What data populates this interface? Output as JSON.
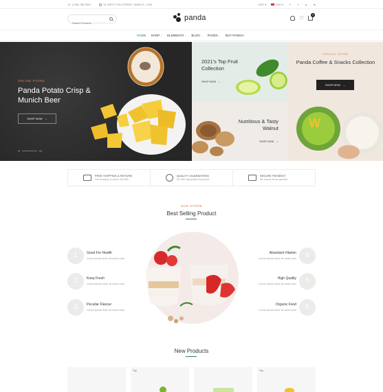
{
  "topbar": {
    "phone": "(+84) 789 9521",
    "address": "31 WEST 37th STREET, MAIN FL, USA",
    "currency": "USD",
    "language": "ENG",
    "social": [
      "f",
      "t",
      "p",
      "in"
    ]
  },
  "header": {
    "search_placeholder": "Search Product",
    "logo_text": "panda",
    "cart_count": "0"
  },
  "nav": {
    "items": [
      {
        "label": "HOME",
        "dropdown": false
      },
      {
        "label": "SHOP",
        "dropdown": true
      },
      {
        "label": "ELEMENTS",
        "dropdown": true
      },
      {
        "label": "BLOG",
        "dropdown": true
      },
      {
        "label": "PAGES",
        "dropdown": true
      },
      {
        "label": "BUY PANDA!",
        "dropdown": false
      }
    ]
  },
  "hero": {
    "main": {
      "kicker": "ONLINE STORE",
      "title": "Panda Potato Crisp & Munich Beer",
      "button": "SHOP NOW",
      "slide_counter": "02"
    },
    "fruit": {
      "title": "2021's Top Fruit Collection",
      "button": "SHOP NOW"
    },
    "walnut": {
      "title": "Nutritious & Tasty Walnut",
      "button": "SHOP NOW"
    },
    "coffee": {
      "kicker": "SPECIAL OFFER",
      "title": "Panda Coffee & Snacks Collection",
      "button": "SHOP NOW"
    }
  },
  "features": [
    {
      "title": "FREE SHIPPING & RETURN",
      "desc": "Free shipping on orders over $80",
      "icon": "truck-icon"
    },
    {
      "title": "QUALITY GUARANTEED",
      "desc": "We offer high quality of products",
      "icon": "dollar-badge-icon"
    },
    {
      "title": "SECURE PAYMENT",
      "desc": "We ensure secure payment",
      "icon": "card-stack-icon"
    }
  ],
  "best_selling": {
    "kicker": "OUR STORE",
    "title": "Best Selling Product",
    "left_items": [
      {
        "num": "1",
        "name": "Good For Health",
        "desc": "Lorem ipsum dolor sit amet cons"
      },
      {
        "num": "2",
        "name": "Keep Fresh",
        "desc": "Lorem ipsum dolor sit amet cons"
      },
      {
        "num": "3",
        "name": "Peculiar Flavour",
        "desc": "Lorem ipsum dolor sit amet cons"
      }
    ],
    "right_items": [
      {
        "num": "4",
        "name": "Abundant Vitamin",
        "desc": "Lorem ipsum dolor sit amet cons"
      },
      {
        "num": "5",
        "name": "High Quality",
        "desc": "Lorem ipsum dolor sit amet cons"
      },
      {
        "num": "6",
        "name": "Organic Food",
        "desc": "Lorem ipsum dolor sit amet cons"
      }
    ]
  },
  "new_products": {
    "title": "New Products",
    "cards": [
      {
        "tag": ""
      },
      {
        "tag": "Top"
      },
      {
        "tag": ""
      },
      {
        "tag": "Top"
      }
    ]
  },
  "colors": {
    "accent_green": "#2f7d4a",
    "accent_orange": "#e07a4c",
    "hero_dark": "#2b2b2b"
  }
}
